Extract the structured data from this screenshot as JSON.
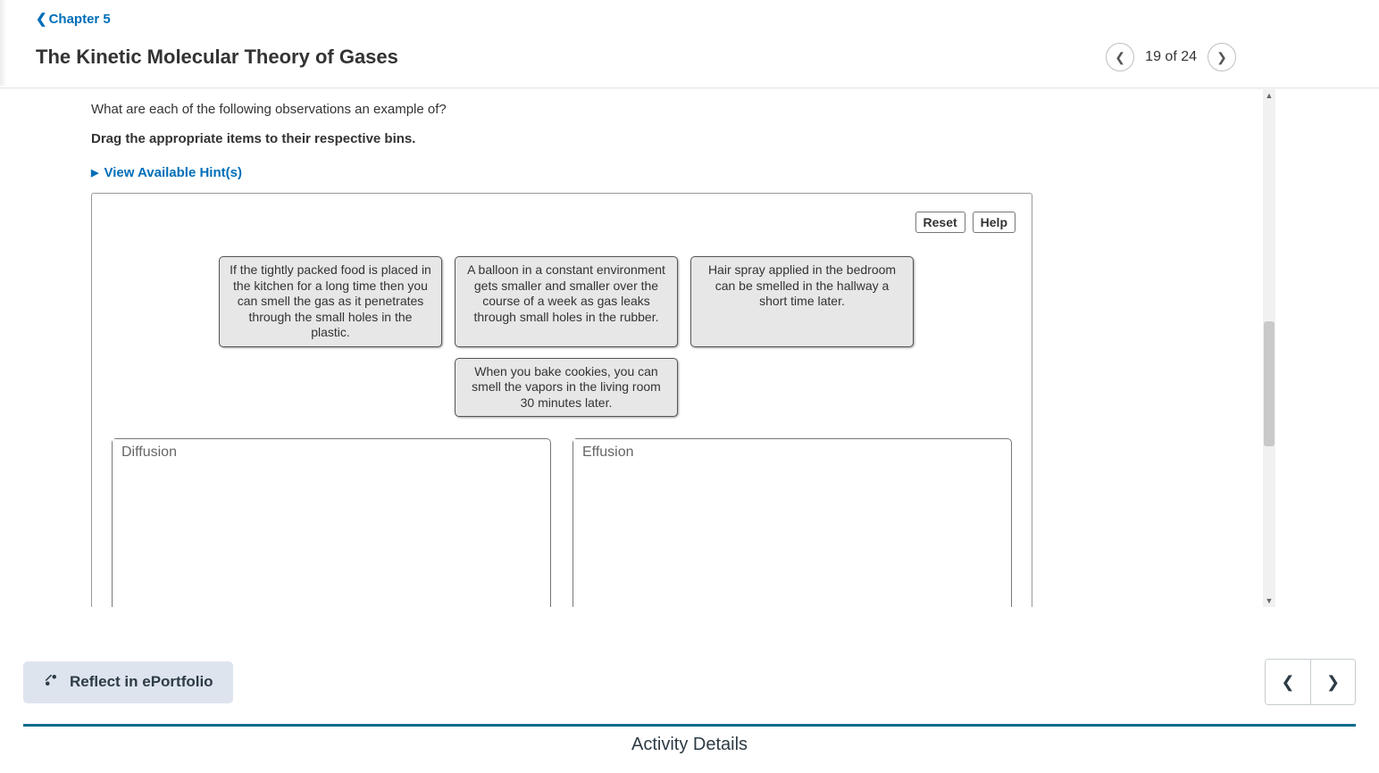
{
  "breadcrumb": {
    "label": "Chapter 5"
  },
  "page": {
    "title": "The Kinetic Molecular Theory of Gases",
    "position": "19 of 24"
  },
  "question": {
    "prompt": "What are each of the following observations an example of?",
    "instruction": "Drag the appropriate items to their respective bins.",
    "hints_label": "View Available Hint(s)"
  },
  "toolbar": {
    "reset": "Reset",
    "help": "Help"
  },
  "cards": [
    "If the tightly packed food is placed in the kitchen for a long time then you can smell the gas as it penetrates through the small holes in the plastic.",
    "A balloon in a constant environment gets smaller and smaller over the course of a week as gas leaks through small holes in the rubber.",
    "Hair spray applied in the bedroom can be smelled in the hallway a short time later.",
    "When you bake cookies, you can smell the vapors in the living room 30 minutes later."
  ],
  "bins": [
    {
      "label": "Diffusion"
    },
    {
      "label": "Effusion"
    }
  ],
  "footer": {
    "reflect": "Reflect in ePortfolio",
    "activity_details": "Activity Details"
  }
}
